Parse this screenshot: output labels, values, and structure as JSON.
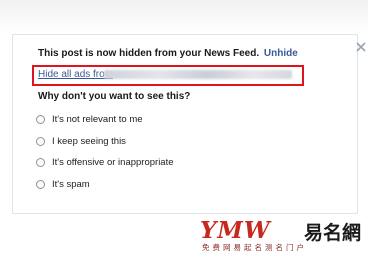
{
  "notice": {
    "hidden_text": "This post is now hidden from your News Feed.",
    "unhide_label": "Unhide"
  },
  "hide_ads": {
    "label": "Hide all ads from"
  },
  "survey": {
    "question": "Why don't you want to see this?",
    "options": [
      {
        "label": "It's not relevant to me"
      },
      {
        "label": "I keep seeing this"
      },
      {
        "label": "It's offensive or inappropriate"
      },
      {
        "label": "It's spam"
      }
    ]
  },
  "watermark": {
    "latin": "YMW",
    "cn_brand": "易名網",
    "cn_sub": "免费网易起名测名门户"
  },
  "colors": {
    "link": "#3b5998",
    "highlight": "#e0141c",
    "watermark": "#c62a1f"
  },
  "icons": {
    "close": "close-icon",
    "radio": "radio-button"
  }
}
